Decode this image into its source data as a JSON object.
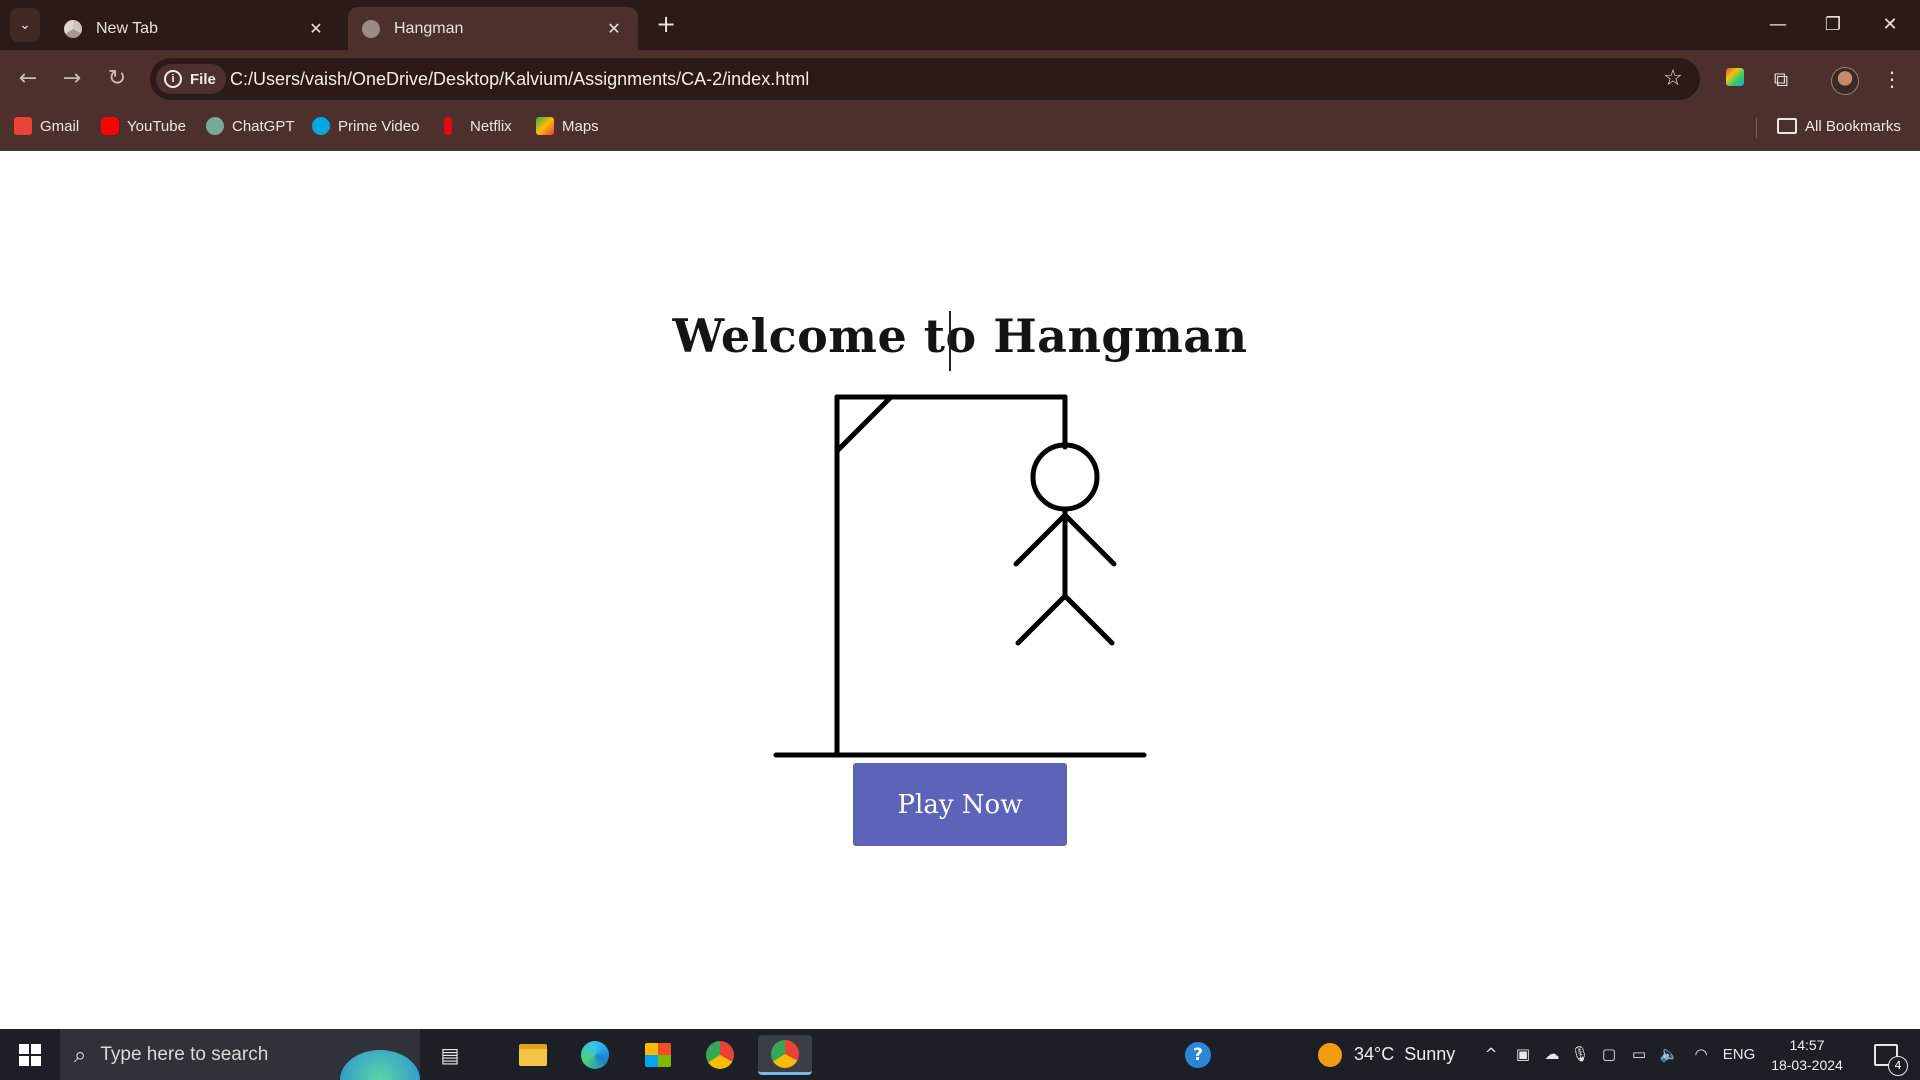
{
  "browser": {
    "tabs": [
      {
        "title": "New Tab",
        "active": false
      },
      {
        "title": "Hangman",
        "active": true
      }
    ],
    "address": {
      "chip_label": "File",
      "url": "C:/Users/vaish/OneDrive/Desktop/Kalvium/Assignments/CA-2/index.html"
    },
    "bookmarks": [
      {
        "label": "Gmail",
        "color": "#ea4335"
      },
      {
        "label": "YouTube",
        "color": "#ff0000"
      },
      {
        "label": "ChatGPT",
        "color": "#74aa9c"
      },
      {
        "label": "Prime Video",
        "color": "#00a8e1"
      },
      {
        "label": "Netflix",
        "color": "#e50914"
      },
      {
        "label": "Maps",
        "color": "#34a853"
      }
    ],
    "all_bookmarks_label": "All Bookmarks",
    "accent_colors": {
      "frame": "#2b1a17",
      "toolbar": "#4d302b"
    }
  },
  "page": {
    "heading": "Welcome to Hangman",
    "play_button_label": "Play Now",
    "play_button_color": "#5c63b8"
  },
  "taskbar": {
    "search_placeholder": "Type here to search",
    "weather": "34°C  Sunny",
    "language": "ENG",
    "time": "14:57",
    "date": "18-03-2024",
    "notification_count": "4"
  }
}
